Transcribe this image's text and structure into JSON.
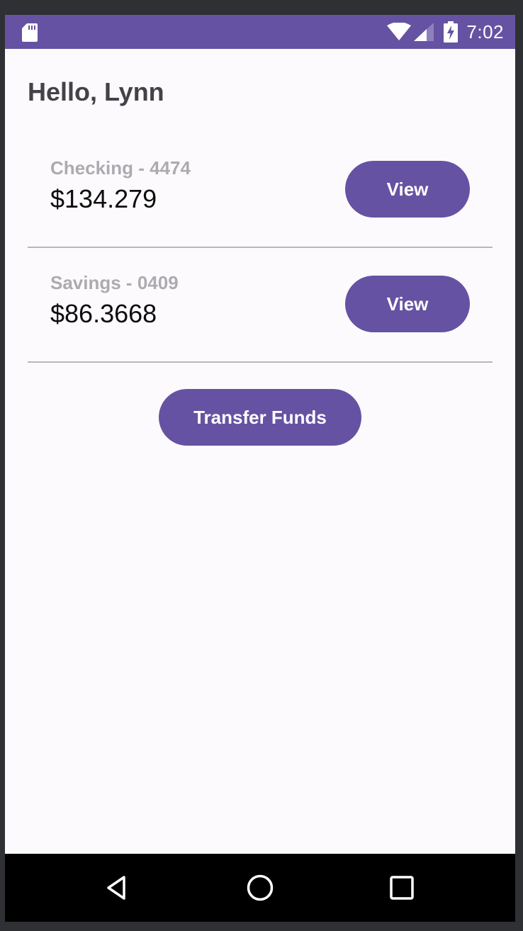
{
  "status_bar": {
    "time": "7:02",
    "icons": [
      "sd-card-icon",
      "wifi-icon",
      "signal-icon",
      "battery-charging-icon"
    ],
    "background_color": "#6652a2"
  },
  "greeting": "Hello, Lynn",
  "accounts": [
    {
      "name": "Checking - 4474",
      "balance": "$134.279",
      "action_label": "View"
    },
    {
      "name": "Savings - 0409",
      "balance": "$86.3668",
      "action_label": "View"
    }
  ],
  "transfer_label": "Transfer Funds",
  "nav_bar": {
    "icons": [
      "back-icon",
      "home-icon",
      "recents-icon"
    ]
  },
  "colors": {
    "accent": "#6652a2",
    "background": "#fdfafd",
    "account_name": "#adabb0",
    "greeting": "#444248"
  }
}
